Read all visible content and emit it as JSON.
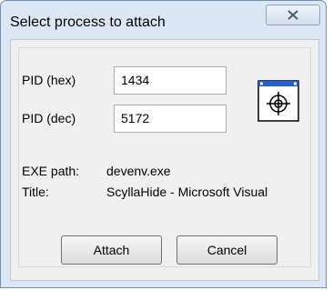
{
  "window": {
    "title": "Select process to attach"
  },
  "form": {
    "pid_hex_label": "PID (hex)",
    "pid_hex_value": "1434",
    "pid_dec_label": "PID (dec)",
    "pid_dec_value": "5172",
    "exe_path_label": "EXE path:",
    "exe_path_value": "devenv.exe",
    "title_label": "Title:",
    "title_value": "ScyllaHide - Microsoft Visual"
  },
  "buttons": {
    "attach": "Attach",
    "cancel": "Cancel"
  },
  "icons": {
    "close": "close-icon",
    "crosshair": "crosshair-target-icon"
  },
  "colors": {
    "accent": "#1f5fd6",
    "face": "#f0f0f0",
    "frame": "#dbe7f5"
  }
}
